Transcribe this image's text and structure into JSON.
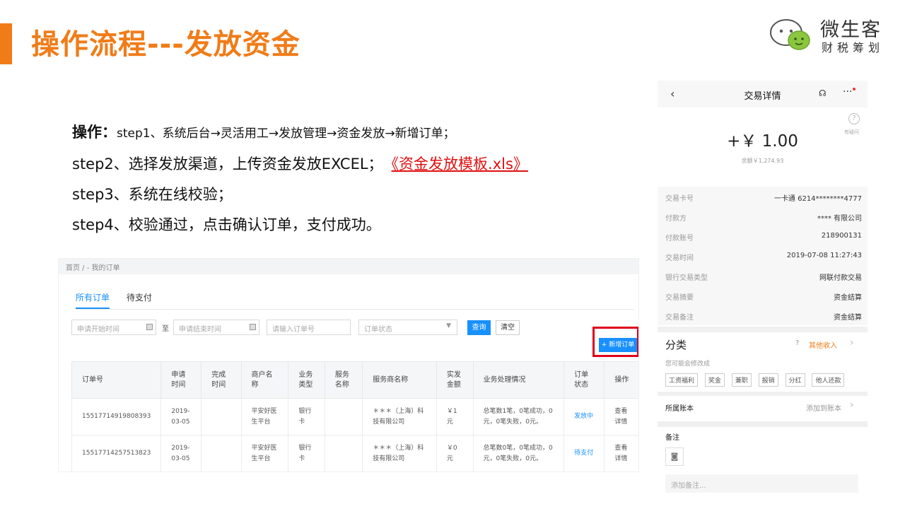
{
  "slide": {
    "title": "操作流程---发放资金",
    "logo_line1": "微生客",
    "logo_line2": "财税筹划"
  },
  "steps": {
    "label": "操作：",
    "step1": "step1、系统后台→灵活用工→发放管理→资金发放→新增订单；",
    "step2": "step2、选择发放渠道，上传资金发放EXCEL；",
    "step2_link": "《资金发放模板.xls》",
    "step3": "step3、系统在线校验；",
    "step4": "step4、校验通过，点击确认订单，支付成功。"
  },
  "orders_screen": {
    "breadcrumb": "首页 /    - 我的订单",
    "tabs": [
      "所有订单",
      "待支付"
    ],
    "filters": {
      "start_placeholder": "申请开始时间",
      "to": "至",
      "end_placeholder": "申请结束时间",
      "order_no_placeholder": "请输入订单号",
      "status_placeholder": "订单状态"
    },
    "query_label": "查询",
    "clear_label": "清空",
    "new_order_label": "+ 新增订单",
    "columns": [
      "订单号",
      "申请时间",
      "完成时间",
      "商户名称",
      "业务类型",
      "服务名称",
      "服务商名称",
      "实发金额",
      "业务处理情况",
      "订单状态",
      "操作"
    ],
    "rows": [
      {
        "order_no": "15517714919808393",
        "apply_time": "2019-03-05",
        "finish_time": "",
        "merchant": "平安好医生平台",
        "biz_type": "银行卡",
        "service": "",
        "provider": "＊＊＊（上海）科技有限公司",
        "amount": "￥1元",
        "process": "总笔数1笔，0笔成功，0元，0笔失败，0元。",
        "status": "发放中",
        "action": "查看详情"
      },
      {
        "order_no": "15517714257513823",
        "apply_time": "2019-03-05",
        "finish_time": "",
        "merchant": "平安好医生平台",
        "biz_type": "银行卡",
        "service": "",
        "provider": "＊＊＊（上海）科技有限公司",
        "amount": "￥0元",
        "process": "总笔数0笔，0笔成功，0元，0笔失败，0元。",
        "status": "待支付",
        "action": "查看详情"
      }
    ]
  },
  "phone_screen": {
    "title": "交易详情",
    "help_label": "有疑问",
    "amount": "+￥ 1.00",
    "balance": "余额￥1,274.93",
    "details": [
      {
        "key": "交易卡号",
        "value": "一卡通 6214********4777"
      },
      {
        "key": "付款方",
        "value": "**** 有限公司"
      },
      {
        "key": "付款账号",
        "value": "218900131"
      },
      {
        "key": "交易时间",
        "value": "2019-07-08 11:27:43"
      },
      {
        "key": "银行交易类型",
        "value": "网联付款交易"
      },
      {
        "key": "交易摘要",
        "value": "资金结算"
      },
      {
        "key": "交易备注",
        "value": "资金结算"
      }
    ],
    "category_title": "分类",
    "category_value": "其他收入",
    "category_hint": "您可能会修改成",
    "category_tags": [
      "工资福利",
      "奖金",
      "兼职",
      "报销",
      "分红",
      "他人还款"
    ],
    "account_label": "所属账本",
    "account_action": "添加到账本",
    "note_label": "备注",
    "note_placeholder": "添加备注..."
  },
  "colors": {
    "accent_orange": "#f07c18",
    "link_red": "#e01010",
    "primary_blue": "#1890ff",
    "highlight_red": "#e0001a"
  }
}
